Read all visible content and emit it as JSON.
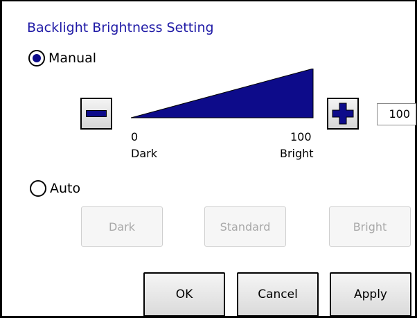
{
  "dialog": {
    "title": "Backlight Brightness Setting"
  },
  "manual": {
    "label": "Manual",
    "selected": true,
    "slider": {
      "min_label": "0",
      "max_label": "100",
      "min_caption": "Dark",
      "max_caption": "Bright",
      "value": 100,
      "fill_color": "#0d0b8a"
    },
    "decrease_icon": "minus-icon",
    "increase_icon": "plus-icon",
    "value_display": "100"
  },
  "auto": {
    "label": "Auto",
    "selected": false,
    "presets": [
      "Dark",
      "Standard",
      "Bright"
    ]
  },
  "actions": {
    "ok": "OK",
    "cancel": "Cancel",
    "apply": "Apply"
  },
  "colors": {
    "accent": "#0d0b8a",
    "title": "#1f1aa6",
    "disabled_text": "#a8a8a8"
  }
}
